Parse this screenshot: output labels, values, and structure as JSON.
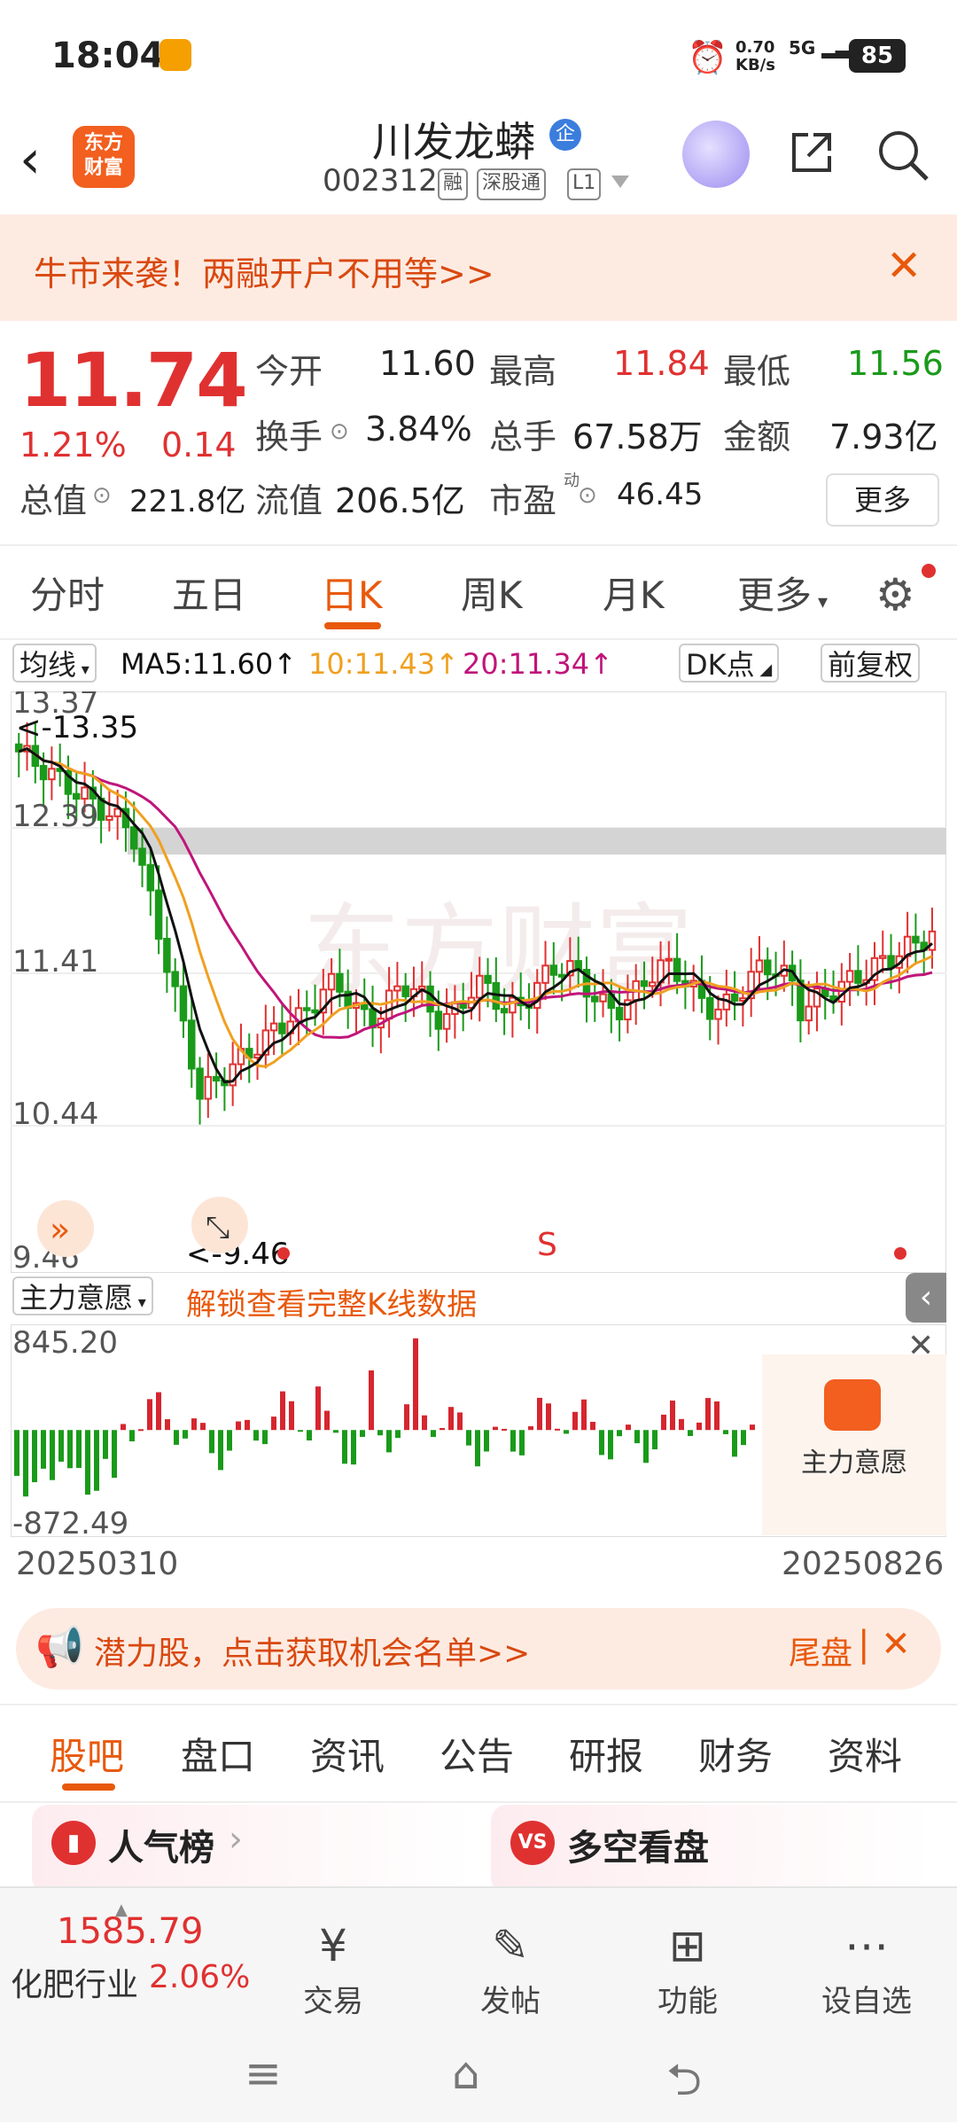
{
  "status_bar": {
    "time": "18:04",
    "net_speed": "0.70",
    "net_unit": "KB/s",
    "signal": "5G",
    "battery": "85"
  },
  "header": {
    "logo_line1": "东方",
    "logo_line2": "财富",
    "stock_name": "川发龙蟒",
    "qi_badge": "企",
    "stock_code": "002312",
    "tags": [
      "融",
      "深股通",
      "L1"
    ]
  },
  "banner": {
    "text": "牛市来袭！两融开户不用等>>"
  },
  "quote": {
    "price": "11.74",
    "change_pct": "1.21%",
    "change": "0.14",
    "open_label": "今开",
    "open": "11.60",
    "high_label": "最高",
    "high": "11.84",
    "low_label": "最低",
    "low": "11.56",
    "turnover_label": "换手",
    "turnover": "3.84%",
    "volume_label": "总手",
    "volume": "67.58万",
    "amount_label": "金额",
    "amount": "7.93亿",
    "mcap_label": "总值",
    "mcap": "221.8亿",
    "float_label": "流值",
    "float_cap": "206.5亿",
    "pe_label": "市盈",
    "pe_sup": "动",
    "pe": "46.45",
    "more": "更多"
  },
  "ktabs": {
    "items": [
      "分时",
      "五日",
      "日K",
      "周K",
      "月K",
      "更多"
    ],
    "active": "日K"
  },
  "ma_row": {
    "selector": "均线",
    "ma5": "MA5:11.60↑",
    "ma10": "10:11.43↑",
    "ma20": "20:11.34↑",
    "dk": "DK点",
    "fq": "前复权"
  },
  "colors": {
    "accent": "#e8590c",
    "up": "#e03131",
    "down": "#1a9a1a",
    "ma5": "#111111",
    "ma10": "#f0a020",
    "ma20": "#c0157a"
  },
  "chart_data": [
    {
      "type": "candlestick",
      "y_ticks": [
        "13.37",
        "12.39",
        "11.41",
        "10.44",
        "9.46"
      ],
      "ylim": [
        9.46,
        13.37
      ],
      "annotations": {
        "high": "<-13.35",
        "low": "<-9.46",
        "signal": "S"
      },
      "x_start": "20250310",
      "x_end": "20250826",
      "ma5_last": 11.6,
      "ma10_last": 11.43,
      "ma20_last": 11.34
    },
    {
      "type": "bar",
      "title": "主力意愿",
      "y_ticks": [
        "845.20",
        "-872.49"
      ],
      "ylim": [
        -872.49,
        845.2
      ]
    }
  ],
  "indicator": {
    "selector": "主力意愿",
    "unlock": "解锁查看完整K线数据",
    "side_label": "主力意愿"
  },
  "dates": {
    "start": "20250310",
    "end": "20250826"
  },
  "promo": {
    "text": "潜力股，点击获取机会名单>>",
    "right": "尾盘"
  },
  "bottom_tabs": {
    "items": [
      "股吧",
      "盘口",
      "资讯",
      "公告",
      "研报",
      "财务",
      "资料"
    ],
    "active": "股吧"
  },
  "cards": {
    "left": "人气榜",
    "right": "多空看盘",
    "vs": "VS"
  },
  "bottom_nav": {
    "index_value": "1585.79",
    "index_name": "化肥行业",
    "index_pct": "2.06%",
    "items": [
      "交易",
      "发帖",
      "功能",
      "设自选"
    ]
  }
}
